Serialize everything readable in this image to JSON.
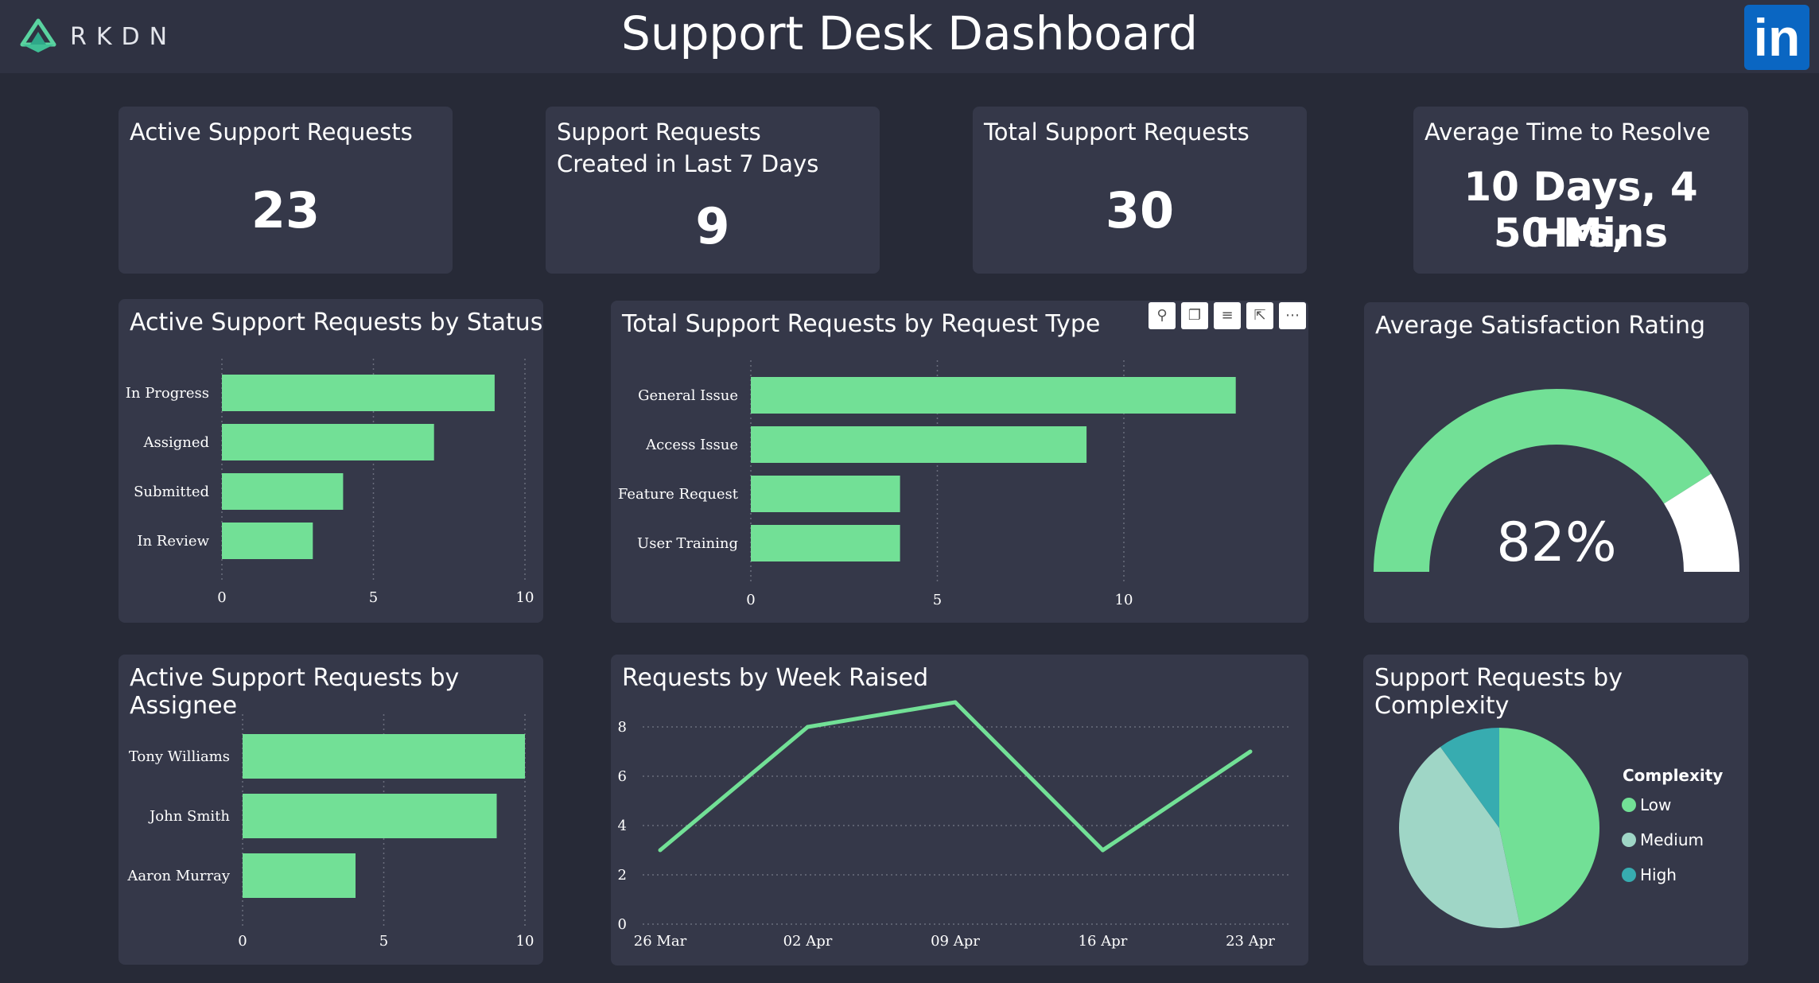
{
  "header": {
    "logo_text": "RKDN",
    "title": "Support Desk Dashboard",
    "linkedin_label": "in"
  },
  "colors": {
    "accent": "#72e096",
    "background": "#272a37",
    "panel": "#353849",
    "medium": "#9fd6c6",
    "high": "#37acb0"
  },
  "kpis": [
    {
      "title": "Active Support Requests",
      "value": "23"
    },
    {
      "title": "Support Requests Created in Last 7 Days",
      "value": "9"
    },
    {
      "title": "Total Support Requests",
      "value": "30"
    },
    {
      "title": "Average Time to Resolve",
      "value_line1": "10 Days, 4 Hrs,",
      "value_line2": "50 Mins"
    }
  ],
  "toolbar_icons": [
    "pin-icon",
    "copy-icon",
    "filter-icon",
    "focus-icon",
    "more-icon"
  ],
  "chart_data": [
    {
      "type": "bar",
      "orientation": "horizontal",
      "title": "Active Support Requests by Status",
      "categories": [
        "In Progress",
        "Assigned",
        "Submitted",
        "In Review"
      ],
      "values": [
        9,
        7,
        4,
        3
      ],
      "xlim": [
        0,
        10
      ],
      "xticks": [
        0,
        5,
        10
      ],
      "color": "#72e096",
      "grid": true
    },
    {
      "type": "bar",
      "orientation": "horizontal",
      "title": "Total Support Requests by Request Type",
      "categories": [
        "General Issue",
        "Access Issue",
        "Feature Request",
        "User Training"
      ],
      "values": [
        13,
        9,
        4,
        4
      ],
      "xlim": [
        0,
        14
      ],
      "xticks": [
        0,
        5,
        10
      ],
      "color": "#72e096",
      "grid": true
    },
    {
      "type": "gauge",
      "title": "Average Satisfaction Rating",
      "value": 82,
      "max": 100,
      "label": "82%",
      "color": "#72e096"
    },
    {
      "type": "bar",
      "orientation": "horizontal",
      "title": "Active Support Requests by Assignee",
      "categories": [
        "Tony Williams",
        "John Smith",
        "Aaron Murray"
      ],
      "values": [
        10,
        9,
        4
      ],
      "xlim": [
        0,
        10
      ],
      "xticks": [
        0,
        5,
        10
      ],
      "color": "#72e096",
      "grid": true
    },
    {
      "type": "line",
      "title": "Requests by Week Raised",
      "x": [
        "26 Mar",
        "02 Apr",
        "09 Apr",
        "16 Apr",
        "23 Apr"
      ],
      "y": [
        3,
        8,
        9,
        3,
        7
      ],
      "ylim": [
        0,
        9
      ],
      "yticks": [
        0,
        2,
        4,
        6,
        8
      ],
      "color": "#72e096",
      "grid": true
    },
    {
      "type": "pie",
      "title": "Support Requests by Complexity",
      "legend_title": "Complexity",
      "legend_position": "right",
      "labels": [
        "Low",
        "Medium",
        "High"
      ],
      "values": [
        14,
        13,
        3
      ],
      "colors": [
        "#72e096",
        "#9fd6c6",
        "#37acb0"
      ]
    }
  ]
}
